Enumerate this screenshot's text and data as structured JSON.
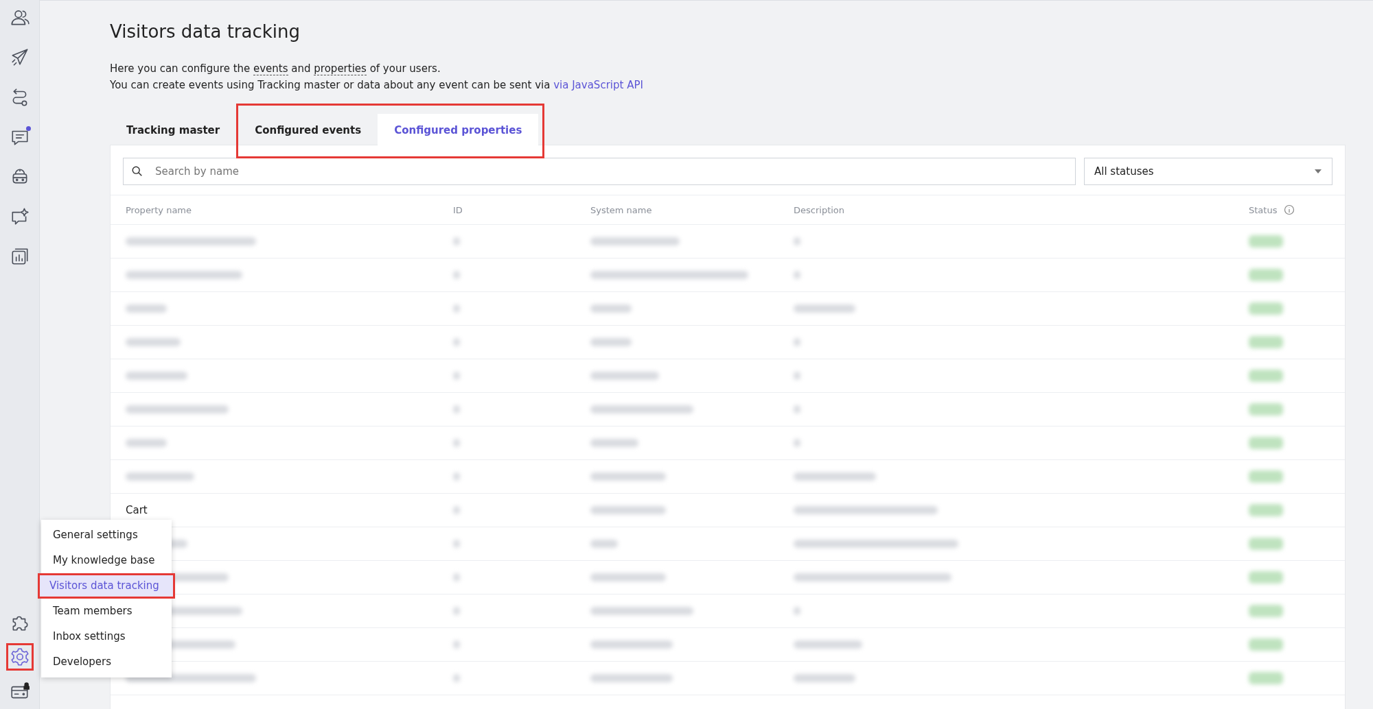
{
  "sidebar": {
    "top_items": [
      {
        "badge": false
      },
      {
        "badge": false
      },
      {
        "badge": false
      },
      {
        "badge": true
      },
      {
        "badge": false
      },
      {
        "badge": false
      },
      {
        "badge": false
      }
    ],
    "bottom_items": [
      {
        "selected": false,
        "highlighted": false,
        "locked": false
      },
      {
        "selected": true,
        "highlighted": true,
        "locked": false
      },
      {
        "selected": false,
        "highlighted": false,
        "locked": true
      }
    ]
  },
  "page": {
    "title": "Visitors data tracking",
    "intro": "Here you can configure the **events** and **properties** of your users.",
    "intro2": "You can create events using Tracking master or data about any event can be sent via",
    "api_link": "via JavaScript API"
  },
  "tabs": [
    {
      "label": "Tracking master",
      "selected": false,
      "highlighted": false
    },
    {
      "label": "Configured events",
      "selected": false,
      "highlighted": true
    },
    {
      "label": "Configured properties",
      "selected": true,
      "highlighted": true
    }
  ],
  "search": {
    "placeholder": "Search by name"
  },
  "status_filter": {
    "value": "All statuses"
  },
  "table": {
    "columns": [
      "Property name",
      "ID",
      "System name",
      "Description",
      "Status"
    ],
    "rows": [
      {
        "name": null,
        "description": false
      },
      {
        "name": null,
        "description": false
      },
      {
        "name": null,
        "description": true
      },
      {
        "name": null,
        "description": false
      },
      {
        "name": null,
        "description": false
      },
      {
        "name": null,
        "description": false
      },
      {
        "name": null,
        "description": false
      },
      {
        "name": null,
        "description": true
      },
      {
        "name": "Cart",
        "description": true
      },
      {
        "name": null,
        "description": true
      },
      {
        "name": null,
        "description": true
      },
      {
        "name": null,
        "description": false
      },
      {
        "name": null,
        "description": true
      },
      {
        "name": null,
        "description": true
      }
    ]
  },
  "menu": {
    "items": [
      {
        "label": "General settings",
        "selected": false,
        "highlighted": false
      },
      {
        "label": "My knowledge base",
        "selected": false,
        "highlighted": false
      },
      {
        "label": "Visitors data tracking",
        "selected": true,
        "highlighted": true
      },
      {
        "label": "Team members",
        "selected": false,
        "highlighted": false
      },
      {
        "label": "Inbox settings",
        "selected": false,
        "highlighted": false
      },
      {
        "label": "Developers",
        "selected": false,
        "highlighted": false
      }
    ]
  }
}
